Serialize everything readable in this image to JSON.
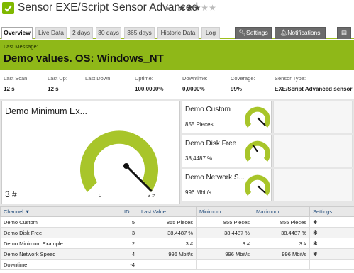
{
  "header": {
    "title": "Sensor EXE/Script Sensor Advanced",
    "flag_icon": "flag-icon",
    "stars": "★★★★★",
    "rating_filled": 3,
    "rating_total": 5
  },
  "tabs": [
    {
      "label": "Overview"
    },
    {
      "label": "Live Data"
    },
    {
      "label": "2 days"
    },
    {
      "label": "30 days"
    },
    {
      "label": "365 days"
    },
    {
      "label": "Historic Data"
    },
    {
      "label": "Log"
    },
    {
      "label": "Settings"
    },
    {
      "label": "Notifications"
    }
  ],
  "message": {
    "label": "Last Message:",
    "text": "Demo values. OS: Windows_NT"
  },
  "stats": [
    {
      "label": "Last Scan:",
      "value": "12 s"
    },
    {
      "label": "Last Up:",
      "value": "12 s"
    },
    {
      "label": "Last Down:",
      "value": ""
    },
    {
      "label": "Uptime:",
      "value": "100,0000%"
    },
    {
      "label": "Downtime:",
      "value": "0,0000%"
    },
    {
      "label": "Coverage:",
      "value": "99%"
    },
    {
      "label": "Sensor Type:",
      "value": "EXE/Script Advanced sensor"
    }
  ],
  "big_gauge": {
    "name": "Demo Minimum Ex...",
    "value": "3 #",
    "min": "0",
    "max": "3 #",
    "level": 1.0
  },
  "small_gauges": [
    {
      "name": "Demo Custom",
      "value": "855 Pieces",
      "level": 0.9
    },
    {
      "name": "Demo Disk Free",
      "value": "38,4487 %",
      "level": 0.4
    },
    {
      "name": "Demo Network S...",
      "value": "996 Mbit/s",
      "level": 0.95
    }
  ],
  "table": {
    "headers": {
      "channel": "Channel ▼",
      "id": "ID",
      "last": "Last Value",
      "min": "Minimum",
      "max": "Maximum",
      "settings": "Settings"
    },
    "rows": [
      {
        "channel": "Demo Custom",
        "id": "5",
        "last": "855 Pieces",
        "min": "855 Pieces",
        "max": "855 Pieces"
      },
      {
        "channel": "Demo Disk Free",
        "id": "3",
        "last": "38,4487 %",
        "min": "38,4487 %",
        "max": "38,4487 %"
      },
      {
        "channel": "Demo Minimum Example",
        "id": "2",
        "last": "3 #",
        "min": "3 #",
        "max": "3 #"
      },
      {
        "channel": "Demo Network Speed",
        "id": "4",
        "last": "996 Mbit/s",
        "min": "996 Mbit/s",
        "max": "996 Mbit/s"
      },
      {
        "channel": "Downtime",
        "id": "-4",
        "last": "",
        "min": "",
        "max": ""
      }
    ],
    "gear_glyph": "✱"
  },
  "colors": {
    "accent": "#8fb818",
    "gauge": "#a8c52a"
  }
}
